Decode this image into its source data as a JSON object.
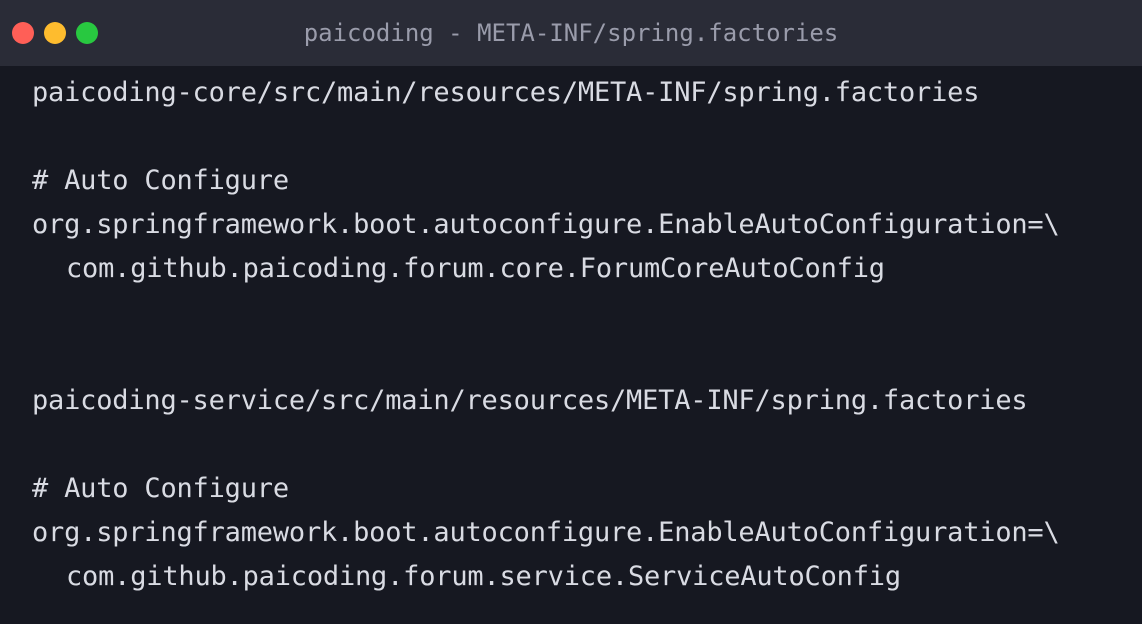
{
  "window": {
    "title": "paicoding - META-INF/spring.factories"
  },
  "code": {
    "lines": [
      "paicoding-core/src/main/resources/META-INF/spring.factories",
      "# Auto Configure",
      "org.springframework.boot.autoconfigure.EnableAutoConfiguration=\\",
      "com.github.paicoding.forum.core.ForumCoreAutoConfig",
      "paicoding-service/src/main/resources/META-INF/spring.factories",
      "# Auto Configure",
      "org.springframework.boot.autoconfigure.EnableAutoConfiguration=\\",
      "com.github.paicoding.forum.service.ServiceAutoConfig"
    ]
  },
  "colors": {
    "background": "#161821",
    "titlebar": "#2a2c37",
    "text": "#d9dbe3",
    "title_text": "#9a9cab",
    "close": "#ff5f57",
    "minimize": "#febc2e",
    "zoom": "#28c840"
  }
}
